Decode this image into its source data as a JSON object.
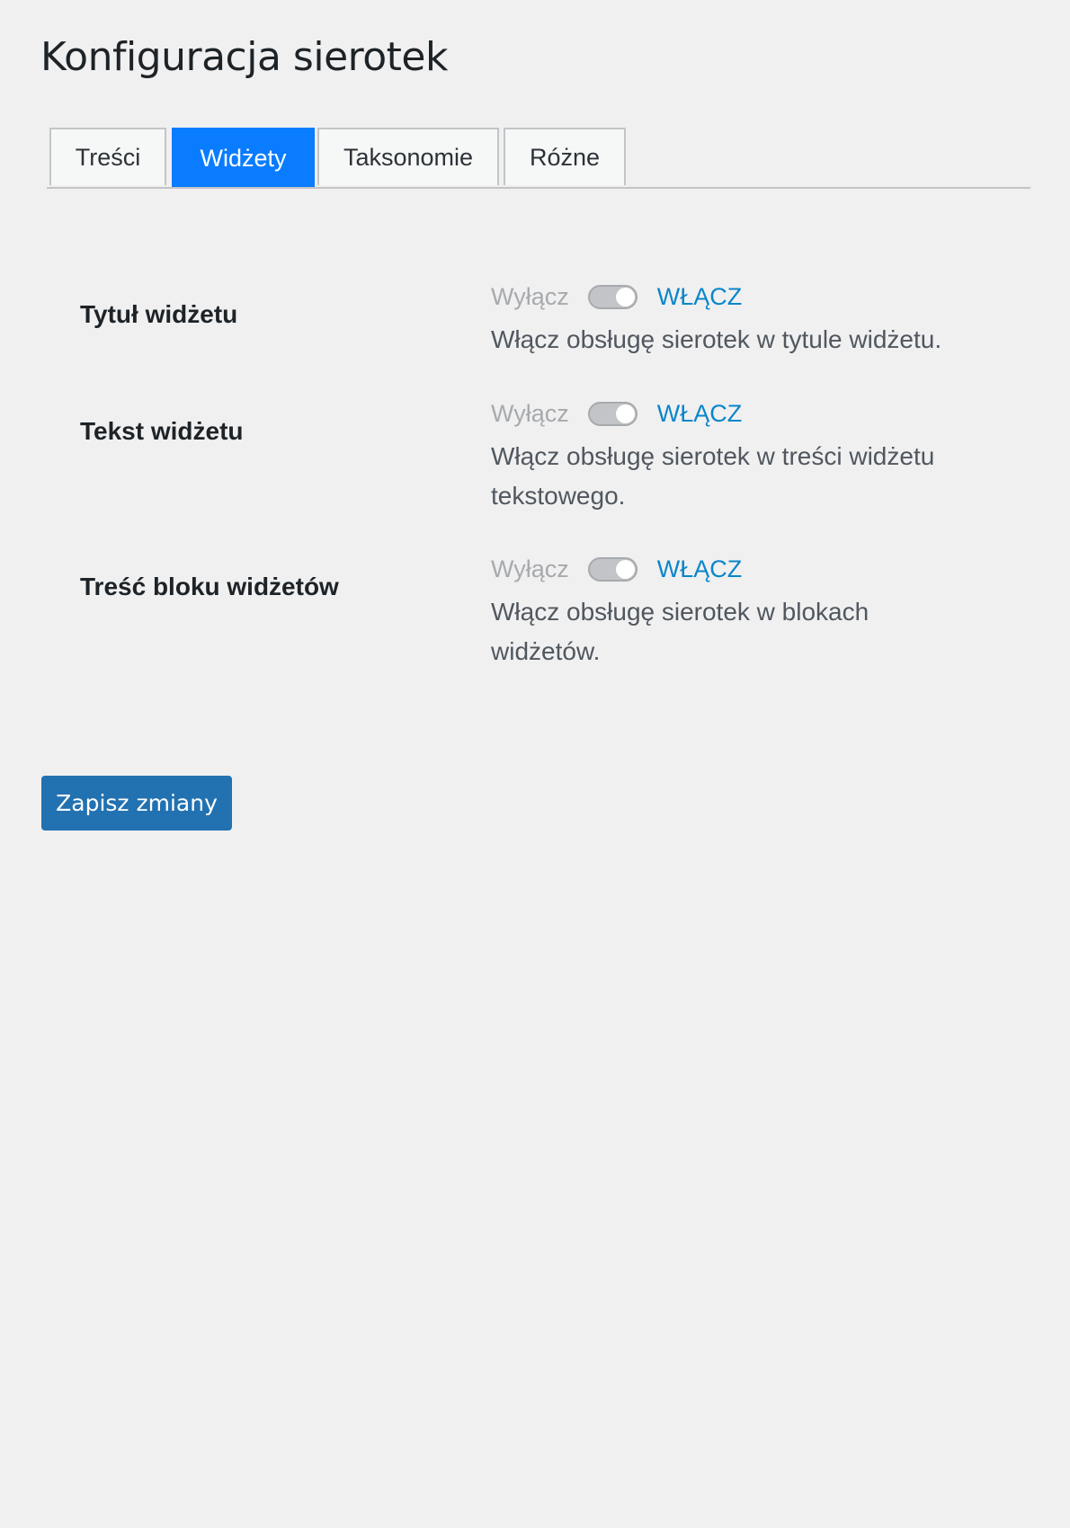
{
  "page": {
    "title": "Konfiguracja sierotek"
  },
  "tabs": [
    {
      "label": "Treści",
      "active": false
    },
    {
      "label": "Widżety",
      "active": true
    },
    {
      "label": "Taksonomie",
      "active": false
    },
    {
      "label": "Różne",
      "active": false
    }
  ],
  "settings": [
    {
      "label": "Tytuł widżetu",
      "off_label": "Wyłącz",
      "on_label": "WŁĄCZ",
      "description": "Włącz obsługę sierotek w tytule widżetu."
    },
    {
      "label": "Tekst widżetu",
      "off_label": "Wyłącz",
      "on_label": "WŁĄCZ",
      "description": "Włącz obsługę sierotek w treści widżetu tekstowego."
    },
    {
      "label": "Treść bloku widżetów",
      "off_label": "Wyłącz",
      "on_label": "WŁĄCZ",
      "description": "Włącz obsługę sierotek w blokach widżetów."
    }
  ],
  "actions": {
    "save_label": "Zapisz zmiany"
  },
  "colors": {
    "active_tab": "#0a7cff",
    "primary_button": "#2271b1",
    "on_label": "#0a86c9",
    "background": "#f0f0f1"
  }
}
